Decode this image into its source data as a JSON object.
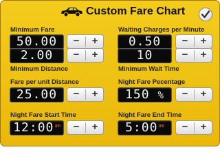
{
  "header": {
    "title": "Custom Fare Chart"
  },
  "fields": {
    "minimum_fare": {
      "label": "Minimum Fare",
      "value": "50.00",
      "value2": "2.00"
    },
    "waiting_charges": {
      "label": "Waiting Charges per Minute",
      "value": "0.50",
      "value2": "10"
    },
    "minimum_distance": {
      "label": "Minimum Distance"
    },
    "minimum_wait_time": {
      "label": "Minimum Wait Time"
    },
    "fare_per_unit_distance": {
      "label": "Fare per unit Distance",
      "value": "25.00"
    },
    "night_fare_percentage": {
      "label": "Night Fare Pecentage",
      "value": "150",
      "suffix": "%"
    },
    "night_fare_start_time": {
      "label": "Night Fare Start Time",
      "value": "12:00",
      "suffix": "am"
    },
    "night_fare_end_time": {
      "label": "Night Fare End Time",
      "value": "5:00",
      "suffix": "am"
    }
  },
  "stepper": {
    "minus": "−",
    "plus": "+"
  },
  "colors": {
    "panel": "#f0c414",
    "lcd_bg": "#0a0a0a",
    "lcd_text": "#f2f2f2",
    "suffix": "#e86a1c"
  },
  "icons": {
    "header": "car-icon",
    "done": "checkmark-icon"
  }
}
